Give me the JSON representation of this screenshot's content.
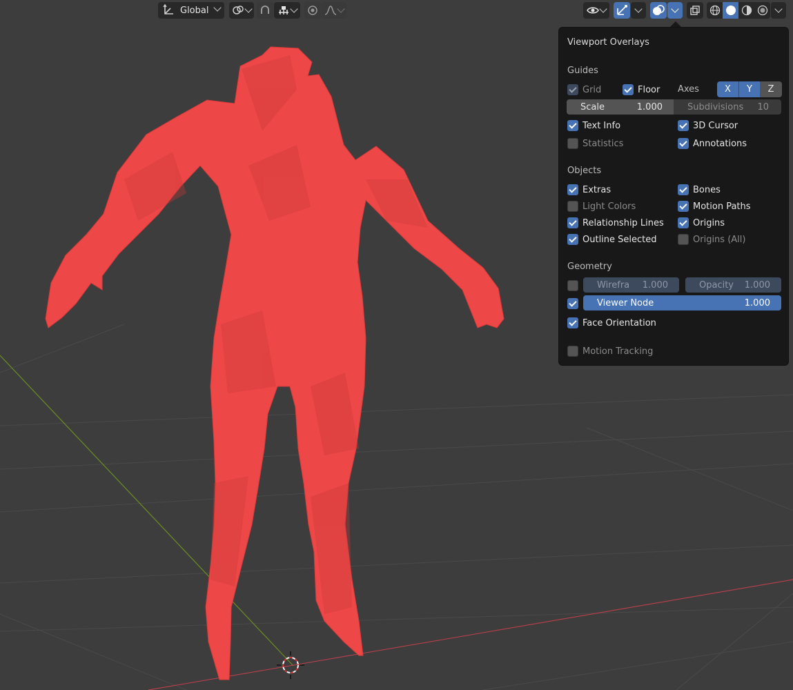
{
  "header": {
    "transform_orientation": "Global",
    "icons": [
      "transform-orientation-icon",
      "pivot-icon",
      "snap-icon",
      "snap-increment-icon",
      "proportional-edit-icon",
      "falloff-icon",
      "visibility-icon",
      "gizmo-icon",
      "overlays-icon",
      "xray-icon",
      "wireframe-shading-icon",
      "solid-shading-icon",
      "material-shading-icon",
      "rendered-shading-icon"
    ]
  },
  "overlays": {
    "title": "Viewport Overlays",
    "guides": {
      "title": "Guides",
      "grid": "Grid",
      "floor": "Floor",
      "axes": "Axes",
      "axis_x": "X",
      "axis_y": "Y",
      "axis_z": "Z",
      "scale_label": "Scale",
      "scale_value": "1.000",
      "subdivisions_label": "Subdivisions",
      "subdivisions_value": "10",
      "text_info": "Text Info",
      "cursor_3d": "3D Cursor",
      "statistics": "Statistics",
      "annotations": "Annotations"
    },
    "objects": {
      "title": "Objects",
      "extras": "Extras",
      "bones": "Bones",
      "light_colors": "Light Colors",
      "motion_paths": "Motion Paths",
      "relationship_lines": "Relationship Lines",
      "origins": "Origins",
      "outline_selected": "Outline Selected",
      "origins_all": "Origins (All)"
    },
    "geometry": {
      "title": "Geometry",
      "wireframe_label": "Wirefra",
      "wireframe_value": "1.000",
      "opacity_label": "Opacity",
      "opacity_value": "1.000",
      "viewer_node_label": "Viewer Node",
      "viewer_node_value": "1.000",
      "face_orientation": "Face Orientation"
    },
    "motion_tracking": "Motion Tracking"
  },
  "colors": {
    "accent": "#4772b3",
    "mesh": "#ee4747",
    "background": "#3d3d3d"
  }
}
